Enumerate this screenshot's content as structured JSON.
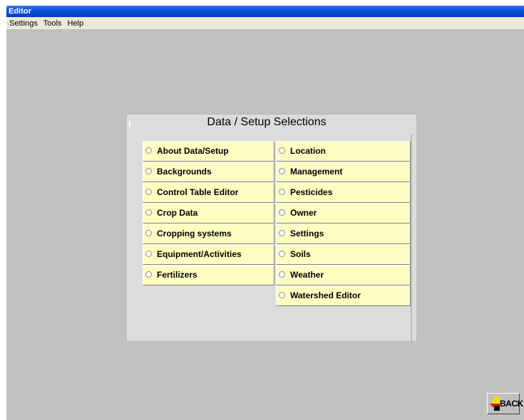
{
  "window": {
    "title": "Editor"
  },
  "menu": [
    "Settings",
    "Tools",
    "Help"
  ],
  "panel": {
    "title": "Data / Setup Selections"
  },
  "options_left": [
    "About Data/Setup",
    "Backgrounds",
    "Control Table Editor",
    "Crop Data",
    "Cropping systems",
    "Equipment/Activities",
    "Fertilizers"
  ],
  "options_right": [
    "Location",
    "Management",
    "Pesticides",
    "Owner",
    "Settings",
    "Soils",
    "Weather",
    "Watershed Editor"
  ],
  "back_button": {
    "label": "BACK",
    "icon": "back-arrow-icon"
  },
  "colors": {
    "titlebar": "#0a4fd8",
    "option_bg": "#fffdc2",
    "panel_bg": "#dcdcdc",
    "window_bg": "#c0c0c0"
  }
}
